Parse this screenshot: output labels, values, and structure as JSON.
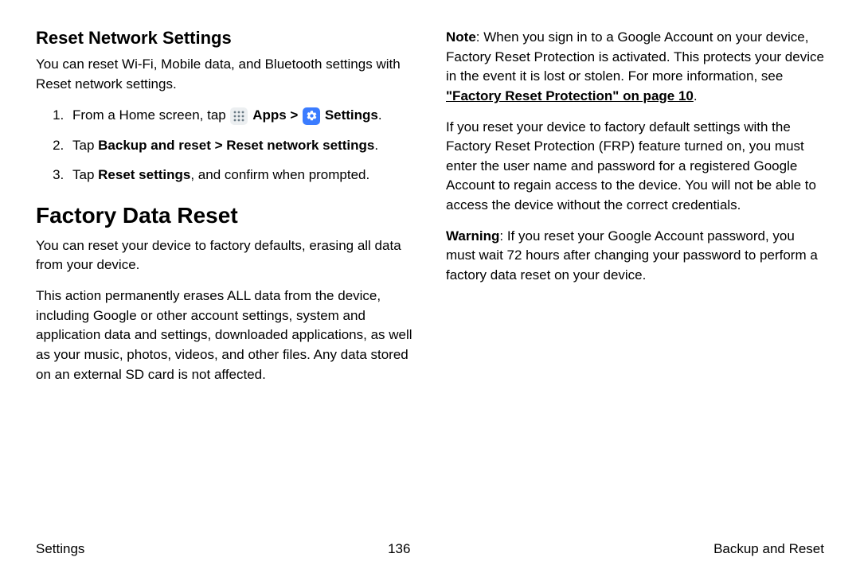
{
  "col1": {
    "h2": "Reset Network Settings",
    "intro": "You can reset Wi-Fi, Mobile data, and Bluetooth settings with Reset network settings.",
    "li1_a": "From a Home screen, tap ",
    "li1_apps": "Apps",
    "li1_sep": " > ",
    "li1_settings": "Settings",
    "li1_end": ".",
    "li2_a": "Tap ",
    "li2_b": "Backup and reset > Reset network settings",
    "li2_c": ".",
    "li3_a": "Tap ",
    "li3_b": "Reset settings",
    "li3_c": ", and confirm when prompted.",
    "h1": "Factory Data Reset",
    "p1": "You can reset your device to factory defaults, erasing all data from your device.",
    "p2": "This action permanently erases ALL data from the device, including Google or other account settings, system and application data and settings, downloaded applications, as well as your music, photos, videos, and other files. Any data stored on an external SD card is not affected."
  },
  "col2": {
    "note_b": "Note",
    "note_txt": ": When you sign in to a Google Account on your device, Factory Reset Protection is activated. This protects your device in the event it is lost or stolen. For more information, see ",
    "note_link": "\"Factory Reset Protection\" on page 10",
    "note_end": ".",
    "p2": "If you reset your device to factory default settings with the Factory Reset Protection (FRP) feature turned on, you must enter the user name and password for a registered Google Account to regain access to the device. You will not be able to access the device without the correct credentials.",
    "warn_b": "Warning",
    "warn_txt": ": If you reset your Google Account password, you must wait 72 hours after changing your password to perform a factory data reset on your device."
  },
  "footer": {
    "left": "Settings",
    "center": "136",
    "right": "Backup and Reset"
  }
}
